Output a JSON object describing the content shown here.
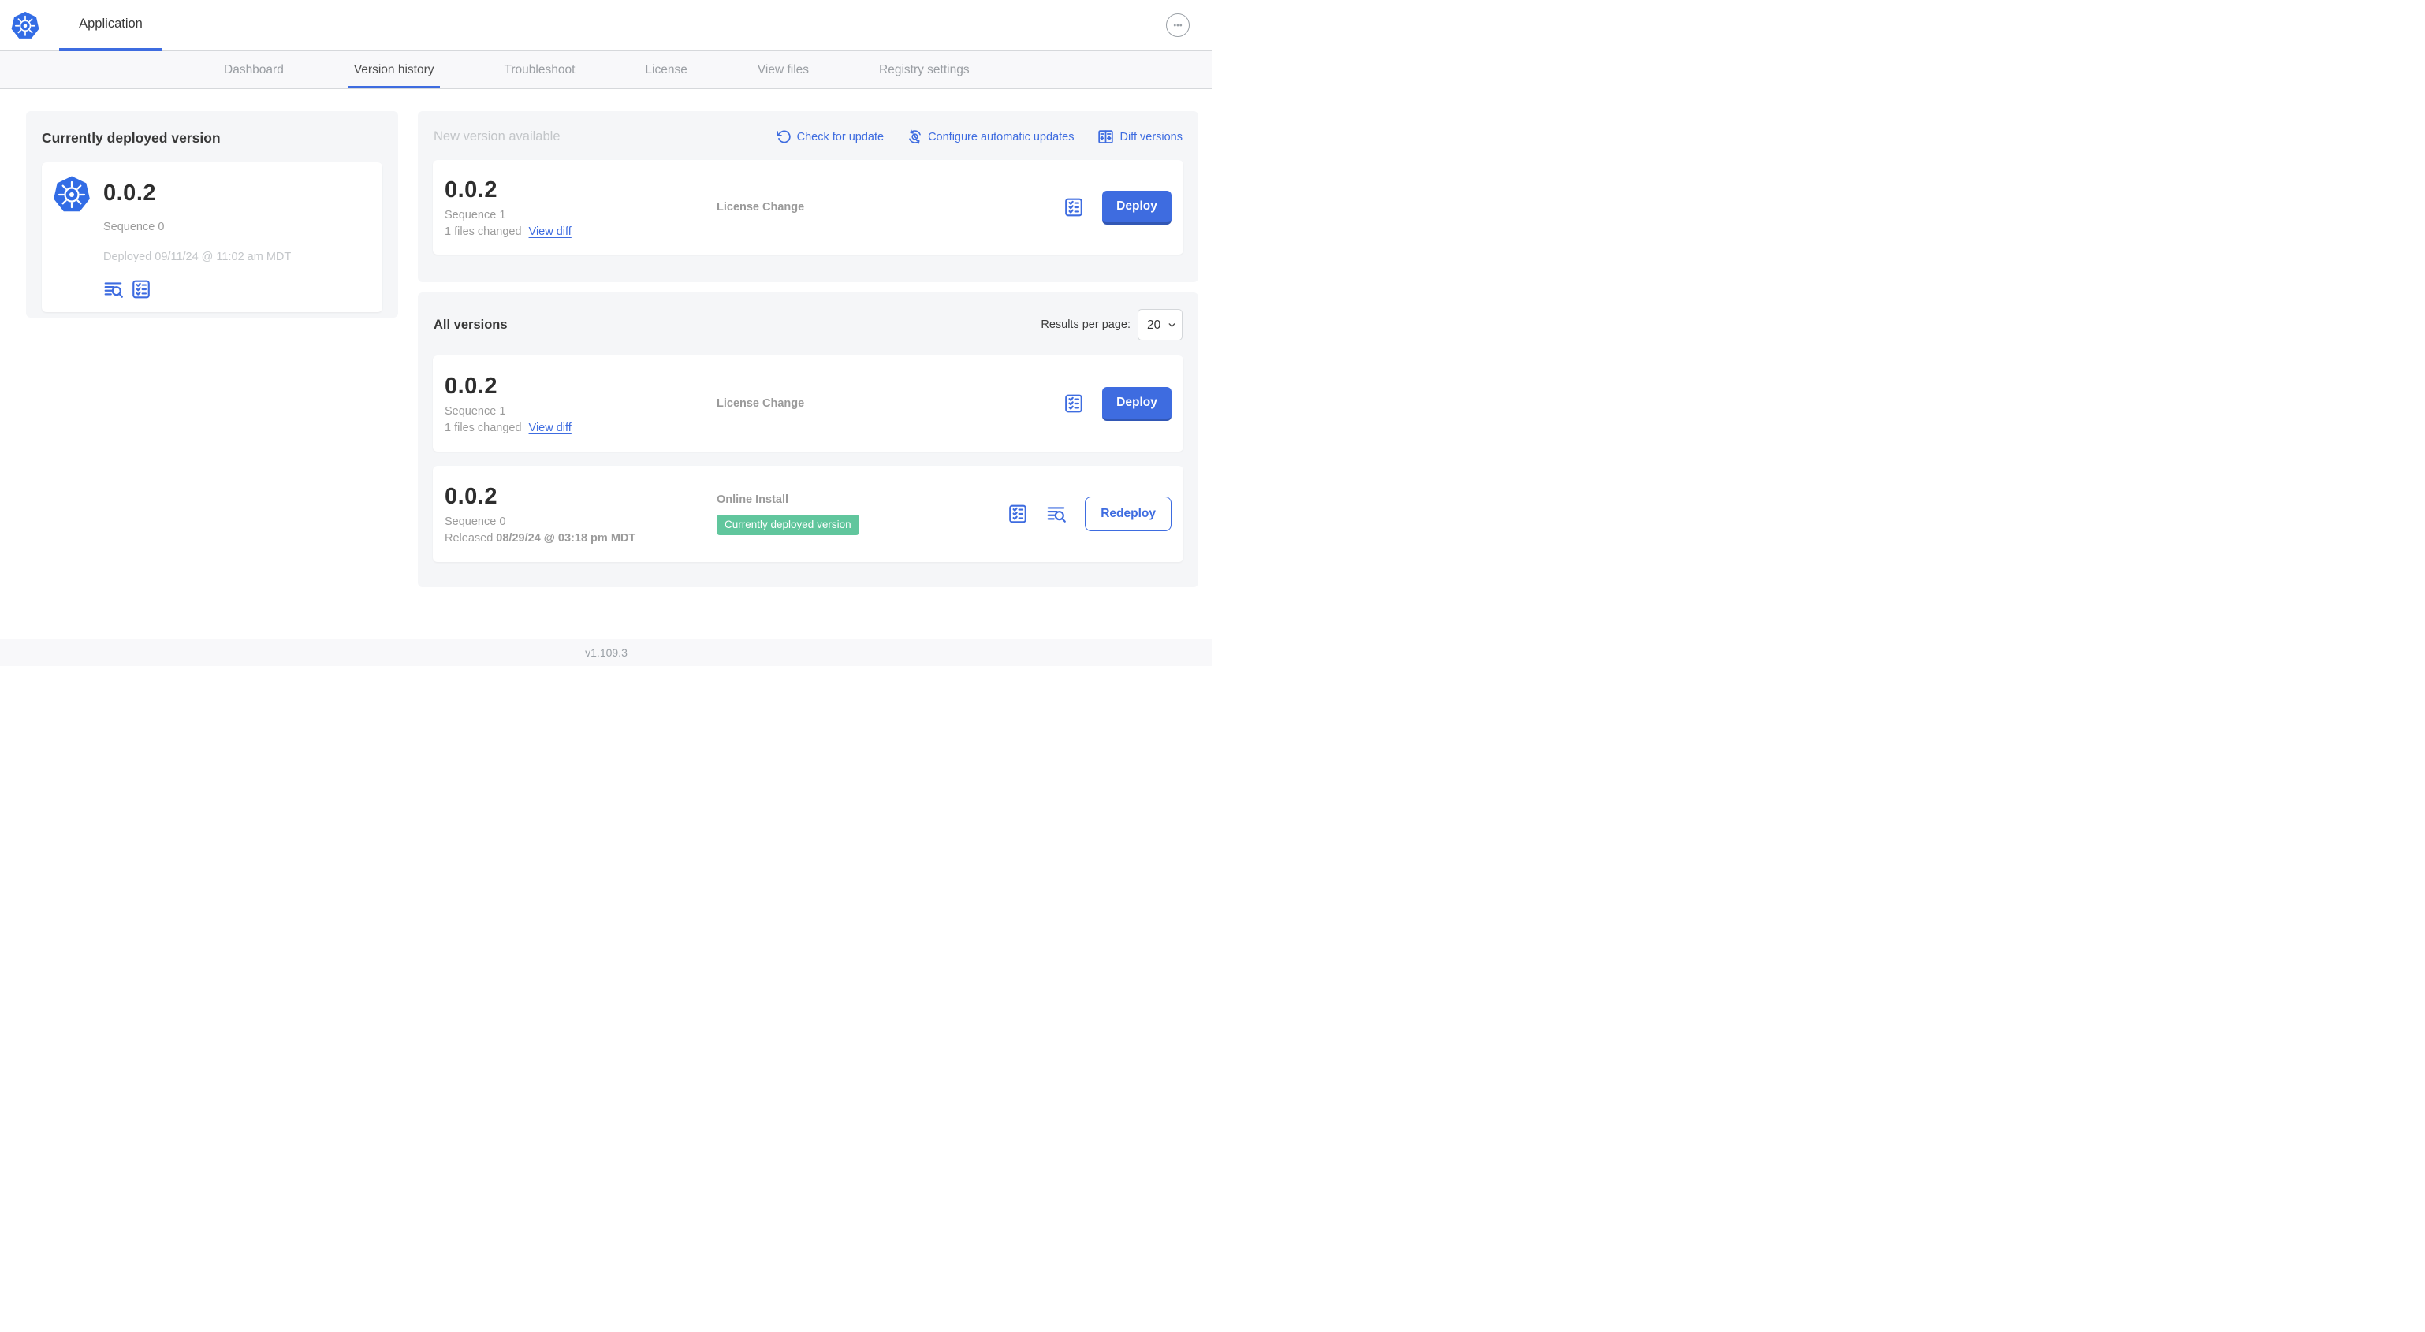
{
  "header": {
    "app_tab_label": "Application"
  },
  "nav_tabs": {
    "dashboard": "Dashboard",
    "version_history": "Version history",
    "troubleshoot": "Troubleshoot",
    "license": "License",
    "view_files": "View files",
    "registry_settings": "Registry settings"
  },
  "current_version_panel": {
    "title": "Currently deployed version",
    "version": "0.0.2",
    "sequence": "Sequence 0",
    "deployed": "Deployed 09/11/24 @ 11:02 am MDT"
  },
  "new_version_panel": {
    "title": "New version available",
    "actions": {
      "check_for_update": "Check for update",
      "configure_automatic_updates": "Configure automatic updates",
      "diff_versions": "Diff versions"
    },
    "card": {
      "version": "0.0.2",
      "sequence": "Sequence 1",
      "files_changed": "1 files changed",
      "view_diff": "View diff",
      "source": "License Change",
      "deploy_button": "Deploy"
    }
  },
  "all_versions_panel": {
    "title": "All versions",
    "results_per_page_label": "Results per page:",
    "results_per_page_value": "20",
    "rows": [
      {
        "version": "0.0.2",
        "sequence": "Sequence 1",
        "files_changed": "1 files changed",
        "view_diff": "View diff",
        "source": "License Change",
        "deploy_button": "Deploy"
      },
      {
        "version": "0.0.2",
        "sequence": "Sequence 0",
        "released_prefix": "Released ",
        "released_date": "08/29/24 @ 03:18 pm MDT",
        "source": "Online Install",
        "status_badge": "Currently deployed version",
        "redeploy_button": "Redeploy"
      }
    ]
  },
  "footer": {
    "app_version": "v1.109.3"
  },
  "colors": {
    "primary_blue": "#3e6ce0",
    "logo_blue": "#326ce5",
    "badge_green": "#61c69d",
    "panel_gray": "#f5f6f8",
    "text_dark": "#383838",
    "text_gray": "#9b9b9b",
    "text_light_gray": "#c3c6c9"
  }
}
